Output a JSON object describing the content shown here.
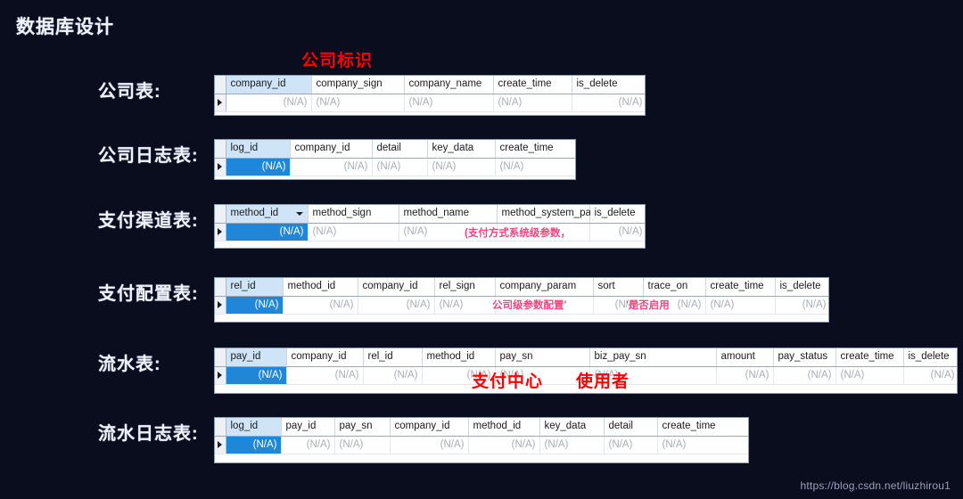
{
  "slide": {
    "title": "数据库设计",
    "watermark": "https://blog.csdn.net/liuzhirou1",
    "na": "(N/A)",
    "background_color": "#0a0d1e",
    "annotation_color": "#ff0000",
    "highlight_color": "#1f86d8",
    "pink_annotation_color": "#f4467f"
  },
  "labels": {
    "company": "公司表:",
    "company_log": "公司日志表:",
    "pay_method": "支付渠道表:",
    "pay_config": "支付配置表:",
    "pay_flow": "流水表:",
    "pay_flow_log": "流水日志表:"
  },
  "annotations": {
    "company_sign": "公司标识",
    "method_system_param": "(支付方式系统级参数，",
    "company_param": "公司级参数配置'",
    "trace_on": "'是否启用",
    "pay_center": "支付中心",
    "user": "使用者"
  },
  "tables": [
    {
      "name": "company",
      "columns": [
        "company_id",
        "company_sign",
        "company_name",
        "create_time",
        "is_delete"
      ],
      "row": [
        {
          "value": "(N/A)",
          "align": "right",
          "style": "plain"
        },
        {
          "value": "(N/A)",
          "align": "left",
          "style": "plain"
        },
        {
          "value": "(N/A)",
          "align": "left",
          "style": "plain"
        },
        {
          "value": "(N/A)",
          "align": "left",
          "style": "plain"
        },
        {
          "value": "(N/A)",
          "align": "right",
          "style": "plain"
        }
      ]
    },
    {
      "name": "company_log",
      "columns": [
        "log_id",
        "company_id",
        "detail",
        "key_data",
        "create_time"
      ],
      "row": [
        {
          "value": "(N/A)",
          "align": "right",
          "style": "highlight"
        },
        {
          "value": "(N/A)",
          "align": "right",
          "style": "plain"
        },
        {
          "value": "(N/A)",
          "align": "left",
          "style": "plain"
        },
        {
          "value": "(N/A)",
          "align": "left",
          "style": "plain"
        },
        {
          "value": "(N/A)",
          "align": "left",
          "style": "plain"
        }
      ]
    },
    {
      "name": "pay_method",
      "columns": [
        "method_id",
        "method_sign",
        "method_name",
        "method_system_param",
        "is_delete"
      ],
      "has_dropdown": true,
      "row": [
        {
          "value": "(N/A)",
          "align": "right",
          "style": "highlight"
        },
        {
          "value": "(N/A)",
          "align": "left",
          "style": "plain"
        },
        {
          "value": "(N/A)",
          "align": "left",
          "style": "plain"
        },
        {
          "value": "",
          "align": "left",
          "style": "plain"
        },
        {
          "value": "(N/A)",
          "align": "right",
          "style": "plain"
        }
      ]
    },
    {
      "name": "pay_config",
      "columns": [
        "rel_id",
        "method_id",
        "company_id",
        "rel_sign",
        "company_param",
        "sort",
        "trace_on",
        "create_time",
        "is_delete"
      ],
      "row": [
        {
          "value": "(N/A)",
          "align": "right",
          "style": "highlight"
        },
        {
          "value": "(N/A)",
          "align": "right",
          "style": "plain"
        },
        {
          "value": "(N/A)",
          "align": "right",
          "style": "plain"
        },
        {
          "value": "(N/A)",
          "align": "left",
          "style": "plain"
        },
        {
          "value": "",
          "align": "left",
          "style": "plain"
        },
        {
          "value": "(N/A)",
          "align": "right",
          "style": "plain"
        },
        {
          "value": "(N/A)",
          "align": "right",
          "style": "plain"
        },
        {
          "value": "(N/A)",
          "align": "left",
          "style": "plain"
        },
        {
          "value": "(N/A)",
          "align": "right",
          "style": "plain"
        }
      ]
    },
    {
      "name": "pay_flow",
      "columns": [
        "pay_id",
        "company_id",
        "rel_id",
        "method_id",
        "pay_sn",
        "biz_pay_sn",
        "amount",
        "pay_status",
        "create_time",
        "is_delete"
      ],
      "row": [
        {
          "value": "(N/A)",
          "align": "right",
          "style": "highlight"
        },
        {
          "value": "(N/A)",
          "align": "right",
          "style": "plain"
        },
        {
          "value": "(N/A)",
          "align": "right",
          "style": "plain"
        },
        {
          "value": "(N/A)",
          "align": "right",
          "style": "plain"
        },
        {
          "value": "(N/A)",
          "align": "left",
          "style": "plain"
        },
        {
          "value": "(N/A)",
          "align": "left",
          "style": "plain"
        },
        {
          "value": "(N/A)",
          "align": "right",
          "style": "plain"
        },
        {
          "value": "(N/A)",
          "align": "right",
          "style": "plain"
        },
        {
          "value": "(N/A)",
          "align": "left",
          "style": "plain"
        },
        {
          "value": "(N/A)",
          "align": "right",
          "style": "plain"
        }
      ]
    },
    {
      "name": "pay_flow_log",
      "columns": [
        "log_id",
        "pay_id",
        "pay_sn",
        "company_id",
        "method_id",
        "key_data",
        "detail",
        "create_time"
      ],
      "row": [
        {
          "value": "(N/A)",
          "align": "right",
          "style": "highlight"
        },
        {
          "value": "(N/A)",
          "align": "right",
          "style": "plain"
        },
        {
          "value": "(N/A)",
          "align": "left",
          "style": "plain"
        },
        {
          "value": "(N/A)",
          "align": "right",
          "style": "plain"
        },
        {
          "value": "(N/A)",
          "align": "right",
          "style": "plain"
        },
        {
          "value": "(N/A)",
          "align": "left",
          "style": "plain"
        },
        {
          "value": "(N/A)",
          "align": "left",
          "style": "plain"
        },
        {
          "value": "(N/A)",
          "align": "left",
          "style": "plain"
        }
      ]
    }
  ]
}
